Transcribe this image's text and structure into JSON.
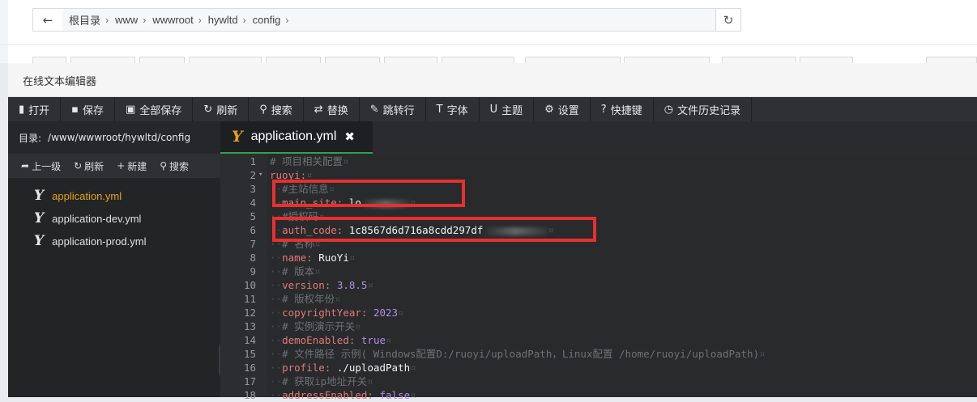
{
  "path_bar": {
    "back_icon": "arrow-left-icon",
    "crumbs": [
      "根目录",
      "www",
      "wwwroot",
      "hywltd",
      "config"
    ],
    "refresh_icon": "refresh-icon"
  },
  "editor": {
    "title": "在线文本编辑器",
    "toolbar": [
      {
        "icon": "open-icon",
        "label": "打开",
        "glyph": "▮"
      },
      {
        "icon": "save-icon",
        "label": "保存",
        "glyph": "▪"
      },
      {
        "icon": "save-all-icon",
        "label": "全部保存",
        "glyph": "▣"
      },
      {
        "icon": "refresh-icon",
        "label": "刷新",
        "glyph": "↻"
      },
      {
        "icon": "search-icon",
        "label": "搜索",
        "glyph": "⚲"
      },
      {
        "icon": "replace-icon",
        "label": "替换",
        "glyph": "⇄"
      },
      {
        "icon": "goto-line-icon",
        "label": "跳转行",
        "glyph": "✎"
      },
      {
        "icon": "font-icon",
        "label": "字体",
        "glyph": "T"
      },
      {
        "icon": "theme-icon",
        "label": "主题",
        "glyph": "U"
      },
      {
        "icon": "settings-icon",
        "label": "设置",
        "glyph": "⚙"
      },
      {
        "icon": "shortcut-icon",
        "label": "快捷键",
        "glyph": "?"
      },
      {
        "icon": "history-icon",
        "label": "文件历史记录",
        "glyph": "◷"
      }
    ],
    "sidebar": {
      "dir_label": "目录:",
      "dir_path": "/www/wwwroot/hywltd/config",
      "tools": [
        {
          "icon": "up-level-icon",
          "label": "上一级",
          "glyph": "➦"
        },
        {
          "icon": "refresh-icon",
          "label": "刷新",
          "glyph": "↻"
        },
        {
          "icon": "new-icon",
          "label": "新建",
          "glyph": "+"
        },
        {
          "icon": "search-icon",
          "label": "搜索",
          "glyph": "⚲"
        }
      ],
      "files": [
        {
          "name": "application.yml",
          "active": true
        },
        {
          "name": "application-dev.yml",
          "active": false
        },
        {
          "name": "application-prod.yml",
          "active": false
        }
      ]
    },
    "tab": {
      "name": "application.yml",
      "close": "✖"
    },
    "lines": [
      {
        "n": "1",
        "indent": "",
        "comment": "# 项目相关配置",
        "key": "",
        "value": "",
        "vclass": "",
        "fold": ""
      },
      {
        "n": "2",
        "indent": "",
        "comment": "",
        "key": "ruoyi:",
        "value": "",
        "vclass": "",
        "fold": "▾"
      },
      {
        "n": "3",
        "indent": "··",
        "comment": "#主站信息",
        "key": "",
        "value": "",
        "vclass": "",
        "fold": ""
      },
      {
        "n": "4",
        "indent": "··",
        "comment": "",
        "key": "main_site:",
        "value": "lo",
        "vclass": "str",
        "fold": "",
        "blur": true
      },
      {
        "n": "5",
        "indent": "··",
        "comment": "#授权码",
        "key": "",
        "value": "",
        "vclass": "",
        "fold": ""
      },
      {
        "n": "6",
        "indent": "··",
        "comment": "",
        "key": "auth_code:",
        "value": "1c8567d6d716a8cdd297df",
        "vclass": "str",
        "fold": "",
        "blur": true
      },
      {
        "n": "7",
        "indent": "··",
        "comment": "# 名称",
        "key": "",
        "value": "",
        "vclass": "",
        "fold": ""
      },
      {
        "n": "8",
        "indent": "··",
        "comment": "",
        "key": "name:",
        "value": "RuoYi",
        "vclass": "str",
        "fold": ""
      },
      {
        "n": "9",
        "indent": "··",
        "comment": "# 版本",
        "key": "",
        "value": "",
        "vclass": "",
        "fold": ""
      },
      {
        "n": "10",
        "indent": "··",
        "comment": "",
        "key": "version:",
        "value": "3.8.5",
        "vclass": "num",
        "fold": ""
      },
      {
        "n": "11",
        "indent": "··",
        "comment": "# 版权年份",
        "key": "",
        "value": "",
        "vclass": "",
        "fold": ""
      },
      {
        "n": "12",
        "indent": "··",
        "comment": "",
        "key": "copyrightYear:",
        "value": "2023",
        "vclass": "num",
        "fold": ""
      },
      {
        "n": "13",
        "indent": "··",
        "comment": "# 实例演示开关",
        "key": "",
        "value": "",
        "vclass": "",
        "fold": ""
      },
      {
        "n": "14",
        "indent": "··",
        "comment": "",
        "key": "demoEnabled:",
        "value": "true",
        "vclass": "bool",
        "fold": ""
      },
      {
        "n": "15",
        "indent": "··",
        "comment": "# 文件路径 示例( Windows配置D:/ruoyi/uploadPath，Linux配置 /home/ruoyi/uploadPath)",
        "key": "",
        "value": "",
        "vclass": "",
        "fold": ""
      },
      {
        "n": "16",
        "indent": "··",
        "comment": "",
        "key": "profile:",
        "value": "./uploadPath",
        "vclass": "str",
        "fold": ""
      },
      {
        "n": "17",
        "indent": "··",
        "comment": "# 获取ip地址开关",
        "key": "",
        "value": "",
        "vclass": "",
        "fold": ""
      },
      {
        "n": "18",
        "indent": "··",
        "comment": "",
        "key": "addressEnabled:",
        "value": "false",
        "vclass": "bool",
        "fold": ""
      }
    ],
    "highlight_color": "#e8302f",
    "accent_color": "#e3a216"
  }
}
